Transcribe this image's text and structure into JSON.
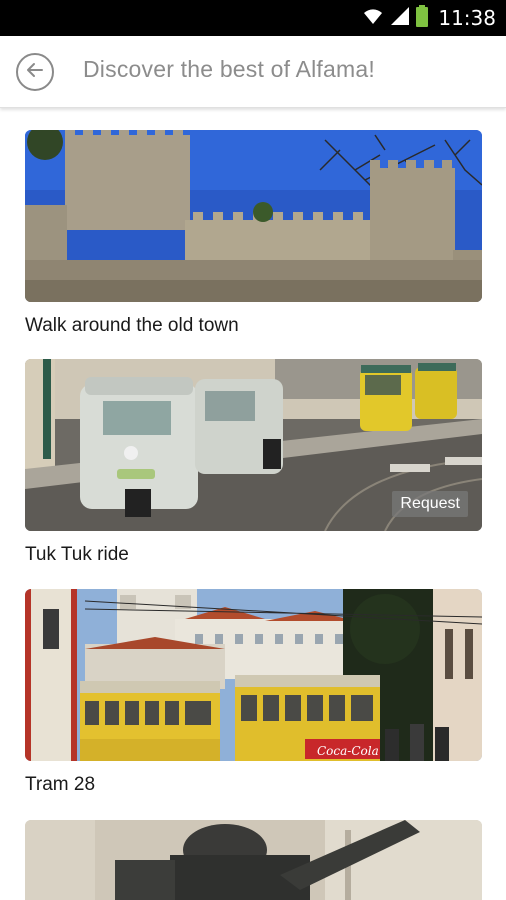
{
  "status_bar": {
    "time": "11:38"
  },
  "header": {
    "title": "Discover the best of Alfama!"
  },
  "cards": [
    {
      "label": "Walk around the old town"
    },
    {
      "label": "Tuk Tuk ride",
      "badge": "Request"
    },
    {
      "label": "Tram 28",
      "tram_ad_text": "Coca-Cola"
    },
    {
      "label": ""
    }
  ]
}
